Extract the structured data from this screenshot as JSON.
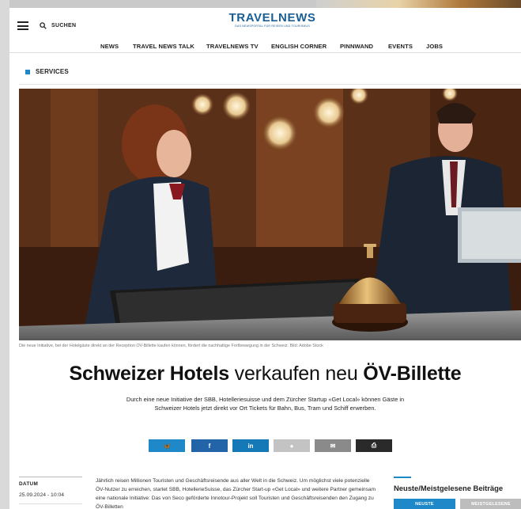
{
  "header": {
    "search_label": "SUCHEN",
    "logo_text": "TRAVELNEWS",
    "logo_tagline": "DAS NEWSPORTAL FÜR REISEN UND TOURISMUS"
  },
  "nav": {
    "items": [
      "NEWS",
      "TRAVEL NEWS TALK",
      "TRAVELNEWS TV",
      "ENGLISH CORNER",
      "PINNWAND",
      "EVENTS",
      "JOBS"
    ]
  },
  "section": {
    "label": "SERVICES"
  },
  "article": {
    "image_caption": "Die neue Initiative, bei der Hotelgäste direkt an der Reception ÖV-Billette kaufen können, fördert die nachhaltige Fortbewegung in der Schweiz. Bild: Adobe Stock",
    "title_part1": "Schweizer Hotels",
    "title_part2": "verkaufen neu",
    "title_part3": "ÖV-Billette",
    "lead": "Durch eine neue Initiative der SBB, Hotelleriesuisse und dem Zürcher Startup «Get Local» können Gäste in Schweizer Hotels jetzt direkt vor Ort Tickets für Bahn, Bus, Tram und Schiff erwerben.",
    "date_label": "DATUM",
    "date_value": "25.09.2024 - 10:04",
    "body": "Jährlich reisen Millionen Touristen und Geschäftsreisende aus aller Welt in die Schweiz. Um möglichst viele potenzielle ÖV-Nutzer zu erreichen, startet SBB, HotellerieSuisse, das Zürcher Start-up «Get Local» und weitere Partner gemeinsam eine nationale Initiative: Das von Seco geförderte Innotour-Projekt soll Touristen und Geschäftsreisenden den Zugang zu ÖV-Billetten"
  },
  "share": [
    {
      "icon": "bluesky-icon",
      "glyph": "🦋",
      "color": "#1e88c8"
    },
    {
      "icon": "facebook-icon",
      "glyph": "f",
      "color": "#2364a8"
    },
    {
      "icon": "linkedin-icon",
      "glyph": "in",
      "color": "#1579b8"
    },
    {
      "icon": "comment-icon",
      "glyph": "●",
      "color": "#c3c3c3"
    },
    {
      "icon": "mail-icon",
      "glyph": "✉",
      "color": "#8a8a8a"
    },
    {
      "icon": "print-icon",
      "glyph": "⎙",
      "color": "#2a2a2a"
    }
  ],
  "sidebar": {
    "title": "Neuste/Meistgelesene Beiträge",
    "tab_newest": "NEUSTE",
    "tab_most_read": "MEISTGELESENE"
  },
  "colors": {
    "accent": "#1e88c8",
    "logo": "#1a5e96"
  }
}
